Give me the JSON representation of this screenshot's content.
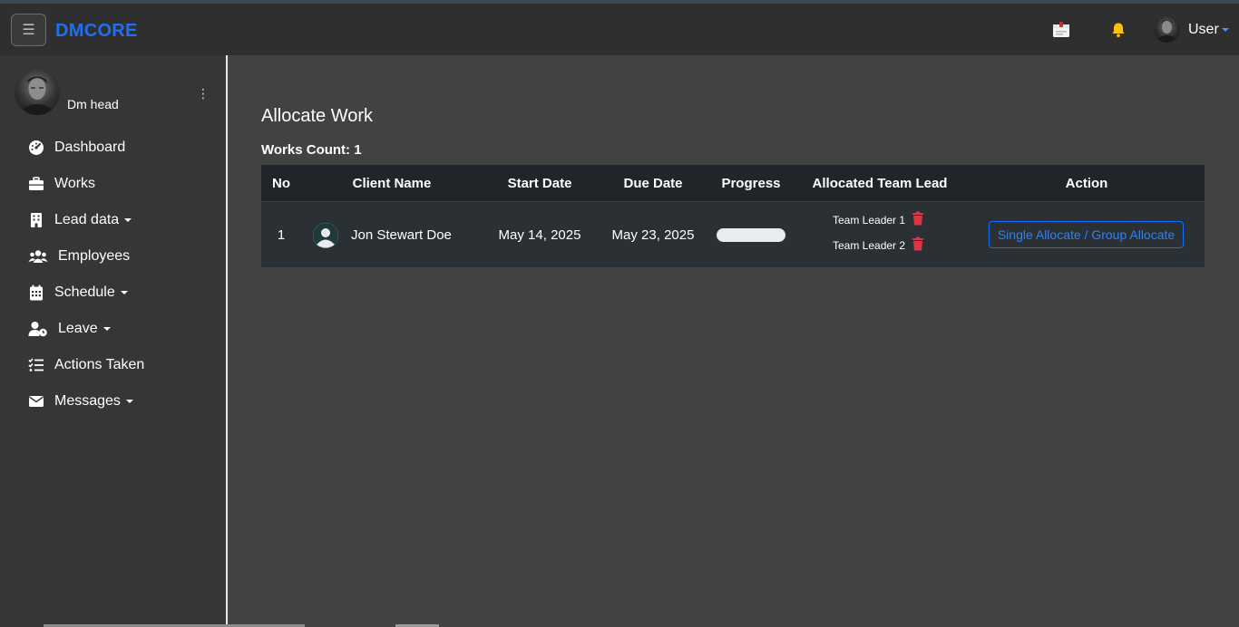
{
  "app": {
    "brand": "DMCORE"
  },
  "navbar": {
    "user_label": "User"
  },
  "sidebar": {
    "profile_name": "Dm head",
    "items": [
      {
        "label": "Dashboard",
        "icon": "gauge-icon",
        "dropdown": false
      },
      {
        "label": "Works",
        "icon": "briefcase-icon",
        "dropdown": false
      },
      {
        "label": "Lead data",
        "icon": "building-icon",
        "dropdown": true
      },
      {
        "label": "Employees",
        "icon": "users-icon",
        "dropdown": false
      },
      {
        "label": "Schedule",
        "icon": "calendar-icon",
        "dropdown": true
      },
      {
        "label": "Leave",
        "icon": "user-clock-icon",
        "dropdown": true
      },
      {
        "label": "Actions Taken",
        "icon": "list-check-icon",
        "dropdown": false
      },
      {
        "label": "Messages",
        "icon": "envelope-icon",
        "dropdown": true
      }
    ]
  },
  "main": {
    "title": "Allocate Work",
    "works_count": "Works Count: 1",
    "table": {
      "headers": [
        "No",
        "Client Name",
        "Start Date",
        "Due Date",
        "Progress",
        "Allocated Team Lead",
        "Action"
      ],
      "rows": [
        {
          "no": "1",
          "client_name": "Jon Stewart Doe",
          "start_date": "May 14, 2025",
          "due_date": "May 23, 2025",
          "progress": 0,
          "team_leads": [
            "Team Leader 1",
            "Team Leader 2"
          ],
          "action_label": "Single Allocate / Group Allocate"
        }
      ]
    }
  },
  "colors": {
    "brand": "#1e6ff2",
    "danger": "#dc3545",
    "primary": "#0d6efd",
    "bell": "#ffc107"
  }
}
